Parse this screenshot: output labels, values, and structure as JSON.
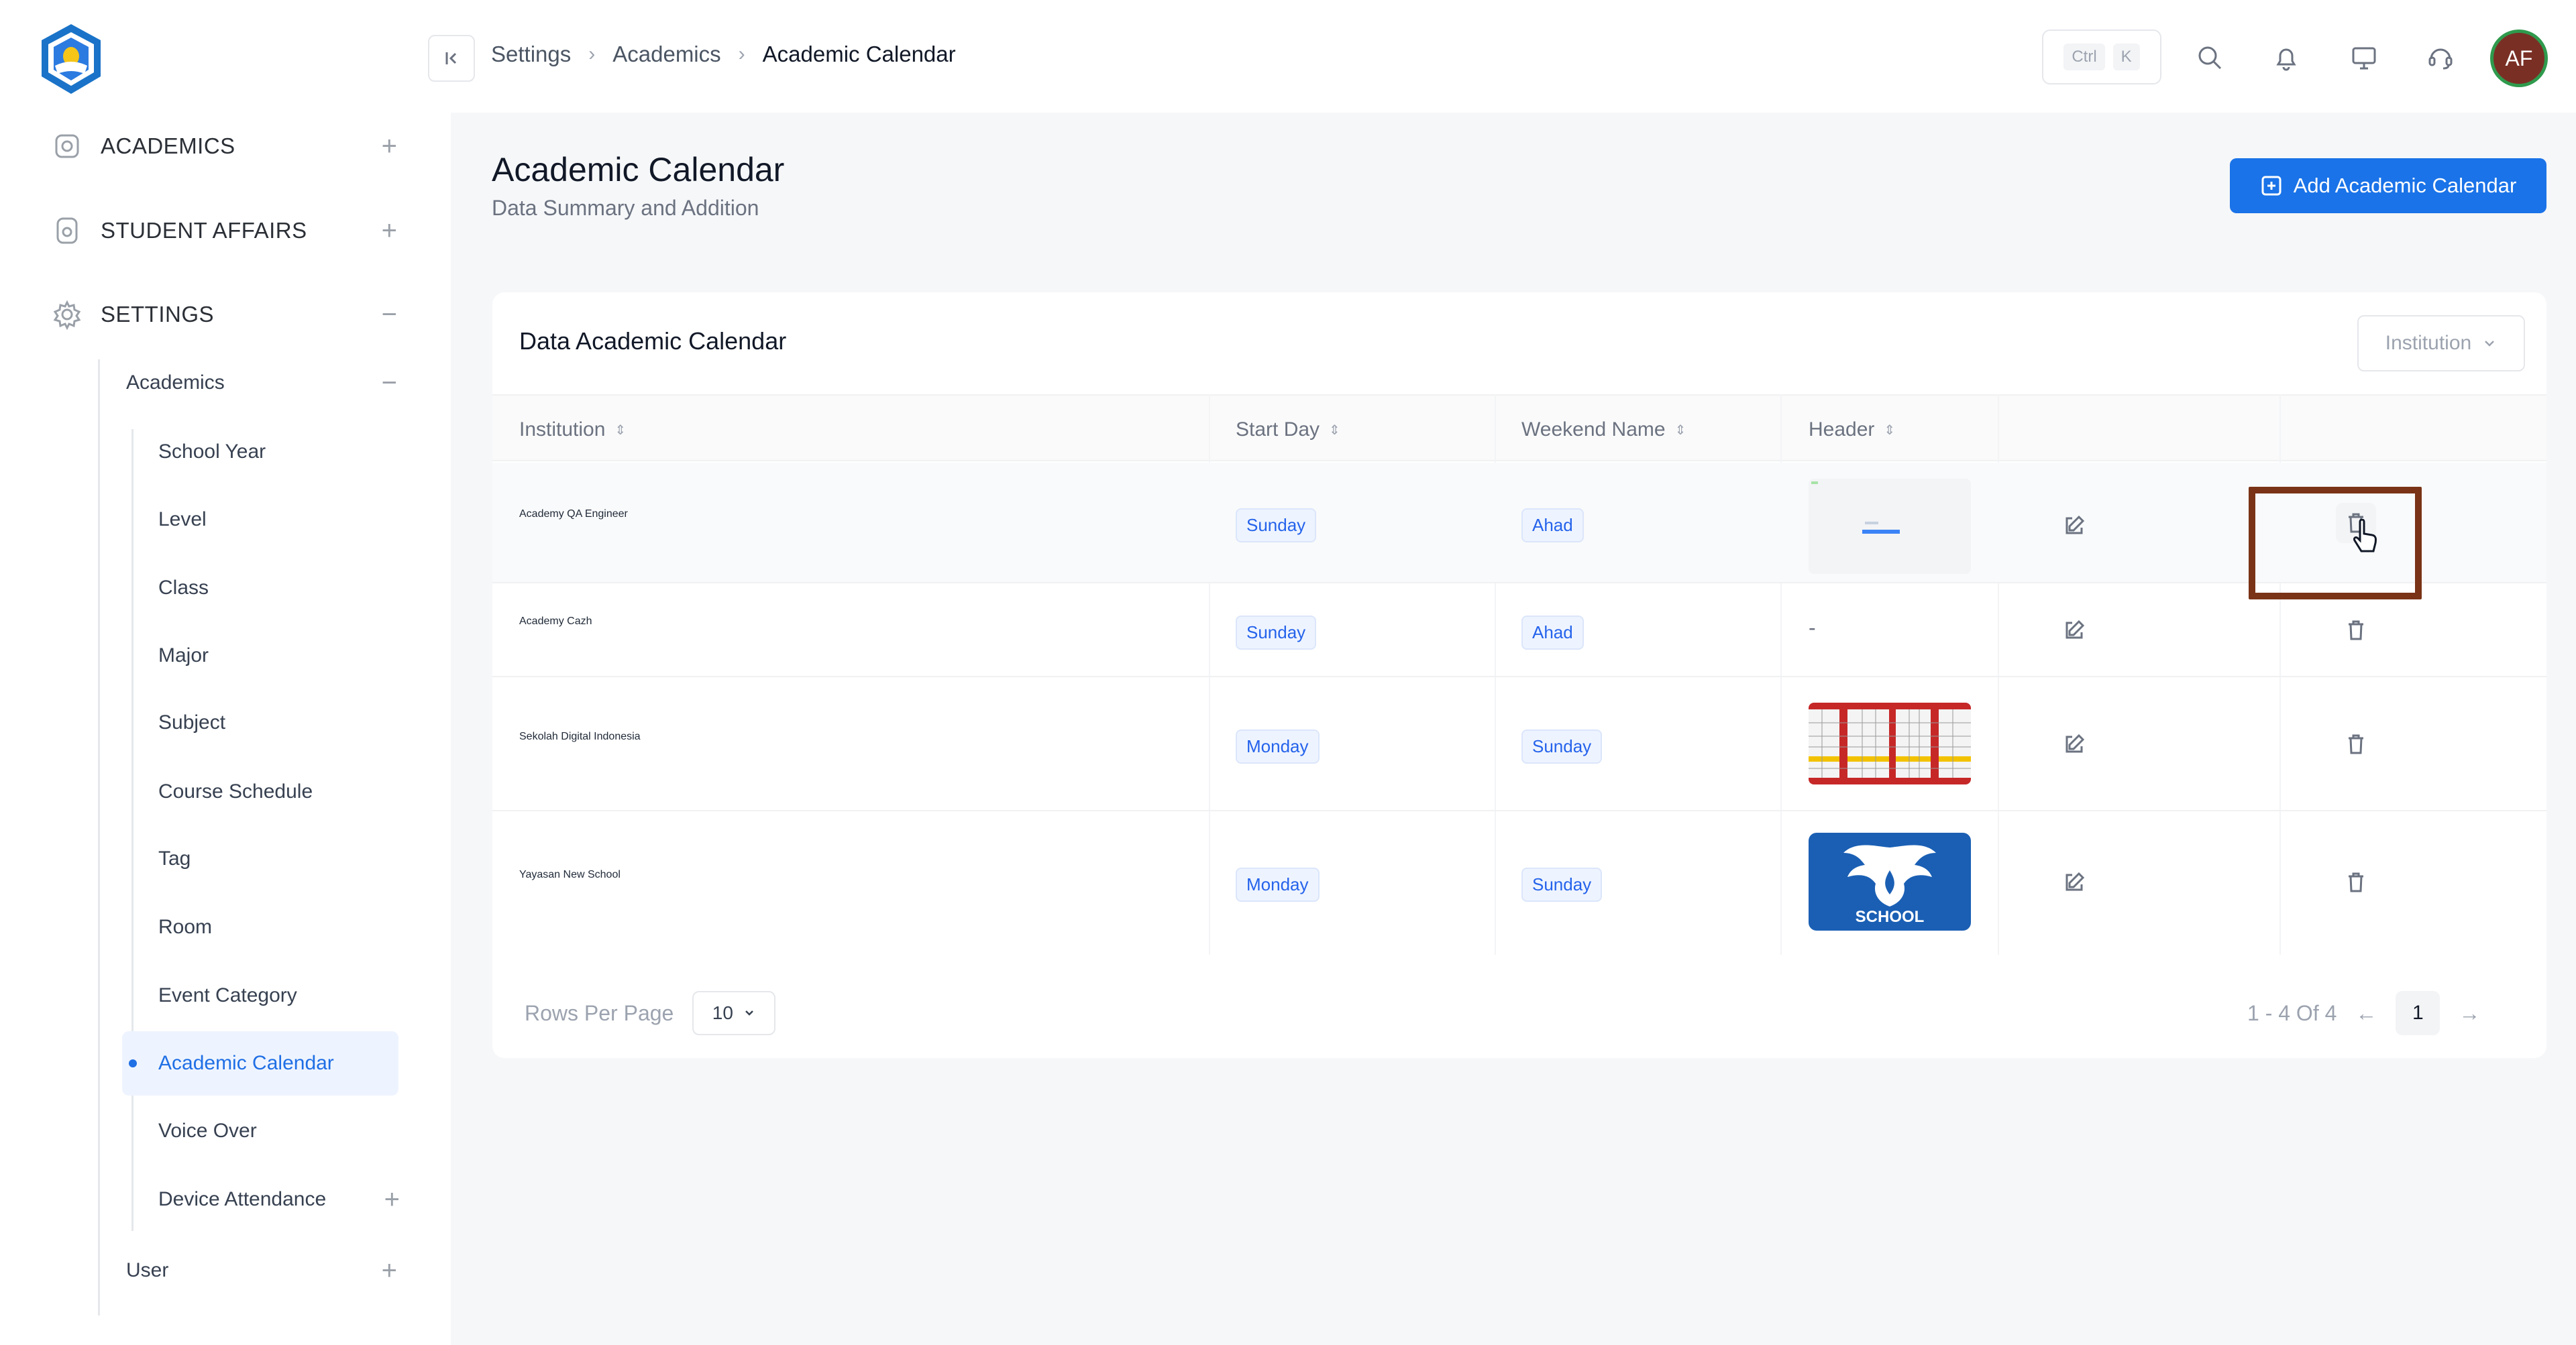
{
  "sidebar": {
    "sections": [
      {
        "label": "ACADEMICS",
        "toggle": "+"
      },
      {
        "label": "STUDENT AFFAIRS",
        "toggle": "+"
      },
      {
        "label": "SETTINGS",
        "toggle": "−"
      }
    ],
    "sub_academics": {
      "label": "Academics",
      "toggle": "−"
    },
    "items": [
      "School Year",
      "Level",
      "Class",
      "Major",
      "Subject",
      "Course Schedule",
      "Tag",
      "Room",
      "Event Category",
      "Academic Calendar",
      "Voice Over",
      "Device Attendance"
    ],
    "device_toggle": "+",
    "user": {
      "label": "User",
      "toggle": "+"
    }
  },
  "topbar": {
    "breadcrumb": [
      "Settings",
      "Academics",
      "Academic Calendar"
    ],
    "shortcut": [
      "Ctrl",
      "K"
    ],
    "avatar_initials": "AF"
  },
  "page": {
    "title": "Academic Calendar",
    "subtitle": "Data Summary and Addition",
    "add_button": "Add Academic Calendar"
  },
  "card": {
    "title": "Data Academic Calendar",
    "filter_label": "Institution",
    "columns": [
      "Institution",
      "Start Day",
      "Weekend Name",
      "Header"
    ],
    "rows": [
      {
        "institution": "Academy QA Engineer",
        "start_day": "Sunday",
        "weekend": "Ahad",
        "header": ""
      },
      {
        "institution": "Academy Cazh",
        "start_day": "Sunday",
        "weekend": "Ahad",
        "header": "-"
      },
      {
        "institution": "Sekolah Digital Indonesia",
        "start_day": "Monday",
        "weekend": "Sunday",
        "header": ""
      },
      {
        "institution": "Yayasan New School",
        "start_day": "Monday",
        "weekend": "Sunday",
        "header": ""
      }
    ],
    "rows_per_page_label": "Rows Per Page",
    "rows_per_page": "10",
    "range": "1 - 4 Of 4",
    "prev": "←",
    "next": "→",
    "current_page": "1",
    "school_logo_text": "SCHOOL"
  },
  "colors": {
    "primary": "#1a73e8",
    "active_nav": "#1f6fe5",
    "highlight": "#7a3317",
    "avatar_bg": "#7a2f25"
  }
}
